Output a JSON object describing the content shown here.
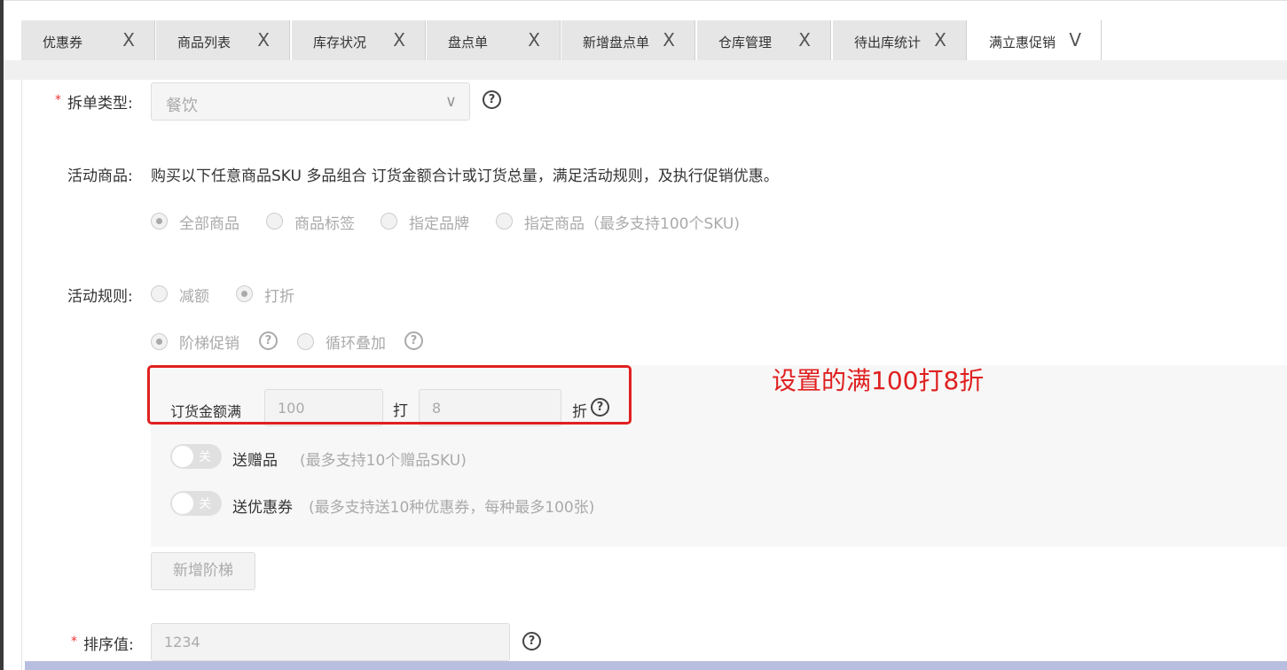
{
  "tabs": [
    {
      "label": "优惠券",
      "close": "X"
    },
    {
      "label": "商品列表",
      "close": "X"
    },
    {
      "label": "库存状况",
      "close": "X"
    },
    {
      "label": "盘点单",
      "close": "X"
    },
    {
      "label": "新增盘点单",
      "close": "X"
    },
    {
      "label": "仓库管理",
      "close": "X"
    },
    {
      "label": "待出库统计",
      "close": "X"
    },
    {
      "label": "满立惠促销",
      "close": "V"
    }
  ],
  "form": {
    "split_type": {
      "required_mark": "*",
      "label": "拆单类型:",
      "value": "餐饮",
      "help": "?"
    },
    "activity_goods": {
      "label": "活动商品:",
      "description": "购买以下任意商品SKU 多品组合 订货金额合计或订货总量，满足活动规则，及执行促销优惠。",
      "options": [
        "全部商品",
        "商品标签",
        "指定品牌",
        "指定商品（最多支持100个SKU)"
      ],
      "selected": "全部商品"
    },
    "activity_rule": {
      "label": "活动规则:",
      "options": [
        "减额",
        "打折"
      ],
      "selected": "打折",
      "modes": [
        "阶梯促销",
        "循环叠加"
      ],
      "selected_mode": "阶梯促销",
      "help": "?"
    },
    "tier": {
      "amount_label": "订货金额满",
      "amount_value": "100",
      "discount_label": "打",
      "discount_value": "8",
      "discount_unit": "折",
      "help": "?"
    },
    "gift": {
      "toggle_text": "关",
      "label": "送赠品",
      "hint": "(最多支持10个赠品SKU)"
    },
    "coupon": {
      "toggle_text": "关",
      "label": "送优惠券",
      "hint": "(最多支持送10种优惠券，每种最多100张)"
    },
    "add_tier_button": "新增阶梯",
    "sort": {
      "required_mark": "*",
      "label": "排序值:",
      "value": "1234",
      "help": "?"
    }
  },
  "annotation": "设置的满100打8折",
  "colors": {
    "annotation": "#e02020",
    "required": "#e33333",
    "tab_bg": "#e6e6e6"
  }
}
